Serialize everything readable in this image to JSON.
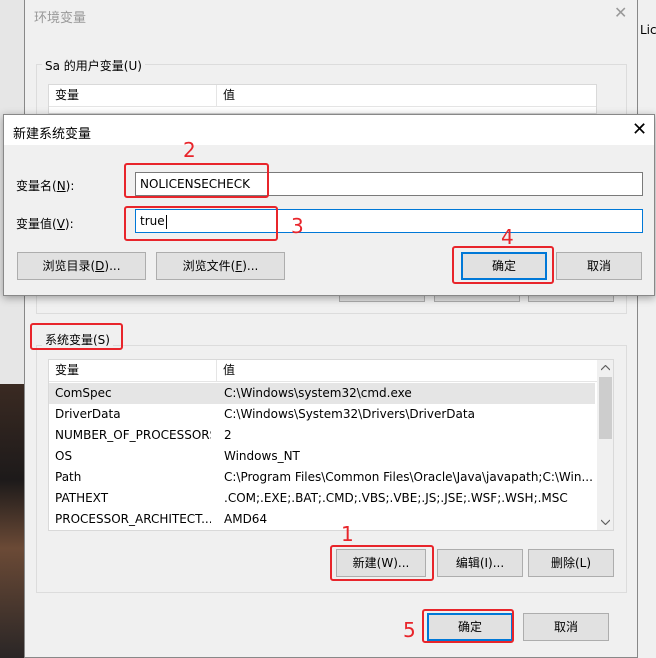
{
  "background": {
    "right_label": "Lic"
  },
  "outer_dialog": {
    "title": "环境变量",
    "close_glyph": "✕",
    "user_vars": {
      "group_label": "Sa 的用户变量(U)",
      "col_name": "变量",
      "col_value": "值"
    },
    "system_vars": {
      "group_label": "系统变量(S)",
      "col_name": "变量",
      "col_value": "值",
      "rows": [
        {
          "name": "ComSpec",
          "value": "C:\\Windows\\system32\\cmd.exe"
        },
        {
          "name": "DriverData",
          "value": "C:\\Windows\\System32\\Drivers\\DriverData"
        },
        {
          "name": "NUMBER_OF_PROCESSORS",
          "value": "2"
        },
        {
          "name": "OS",
          "value": "Windows_NT"
        },
        {
          "name": "Path",
          "value": "C:\\Program Files\\Common Files\\Oracle\\Java\\javapath;C:\\Win..."
        },
        {
          "name": "PATHEXT",
          "value": ".COM;.EXE;.BAT;.CMD;.VBS;.VBE;.JS;.JSE;.WSF;.WSH;.MSC"
        },
        {
          "name": "PROCESSOR_ARCHITECT...",
          "value": "AMD64"
        }
      ],
      "btn_new": "新建(W)...",
      "btn_edit": "编辑(I)...",
      "btn_delete": "删除(L)"
    },
    "btn_ok": "确定",
    "btn_cancel": "取消"
  },
  "new_var_dialog": {
    "title": "新建系统变量",
    "close_glyph": "✕",
    "name_label": "变量名(N):",
    "name_value": "NOLICENSECHECK",
    "value_label": "变量值(V):",
    "value_value": "true",
    "btn_browse_dir": "浏览目录(D)...",
    "btn_browse_file": "浏览文件(F)...",
    "btn_ok": "确定",
    "btn_cancel": "取消"
  },
  "annotations": {
    "step1": "1",
    "step2": "2",
    "step3": "3",
    "step4": "4",
    "step5": "5",
    "color": "#e8252b"
  }
}
